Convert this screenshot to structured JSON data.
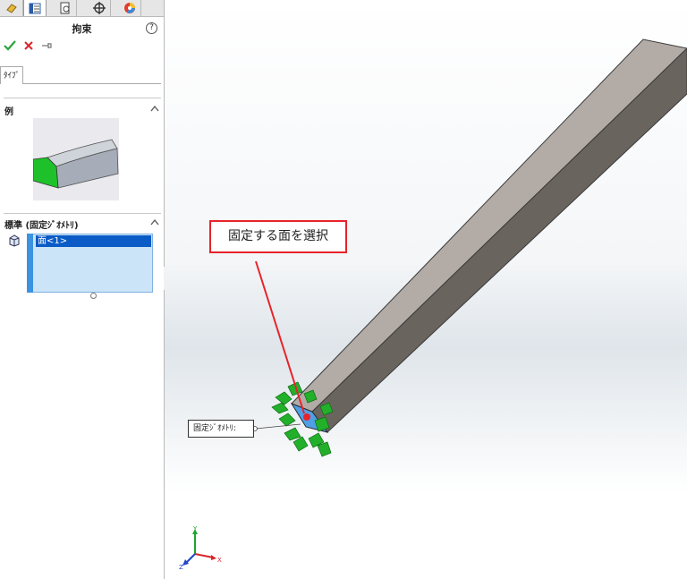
{
  "panel": {
    "title": "拘束",
    "help_icon": "question-icon",
    "tab_icons": [
      "assembly-icon",
      "property-manager-icon",
      "configuration-manager-icon",
      "dimxpert-icon",
      "display-manager-icon"
    ],
    "actions": {
      "ok_icon": "checkmark-icon",
      "cancel_icon": "close-icon",
      "pin_icon": "pushpin-icon"
    },
    "type_tab": "ﾀｲﾌﾟ",
    "example_section": {
      "title": "例"
    },
    "standard_section": {
      "title": "標準 (固定ｼﾞｵﾒﾄﾘ)",
      "selection_item": "面<1>"
    }
  },
  "viewport": {
    "callout_text": "固定する面を選択",
    "fixture_label": "固定ｼﾞｵﾒﾄﾘ:",
    "triad": {
      "x": "X",
      "y": "Y",
      "z": "Z"
    }
  },
  "colors": {
    "accent": "#e8232a",
    "selection": "#0a5bc6",
    "fixture": "#22b02a",
    "beam_top": "#b2aba6",
    "beam_side": "#6a645f"
  }
}
